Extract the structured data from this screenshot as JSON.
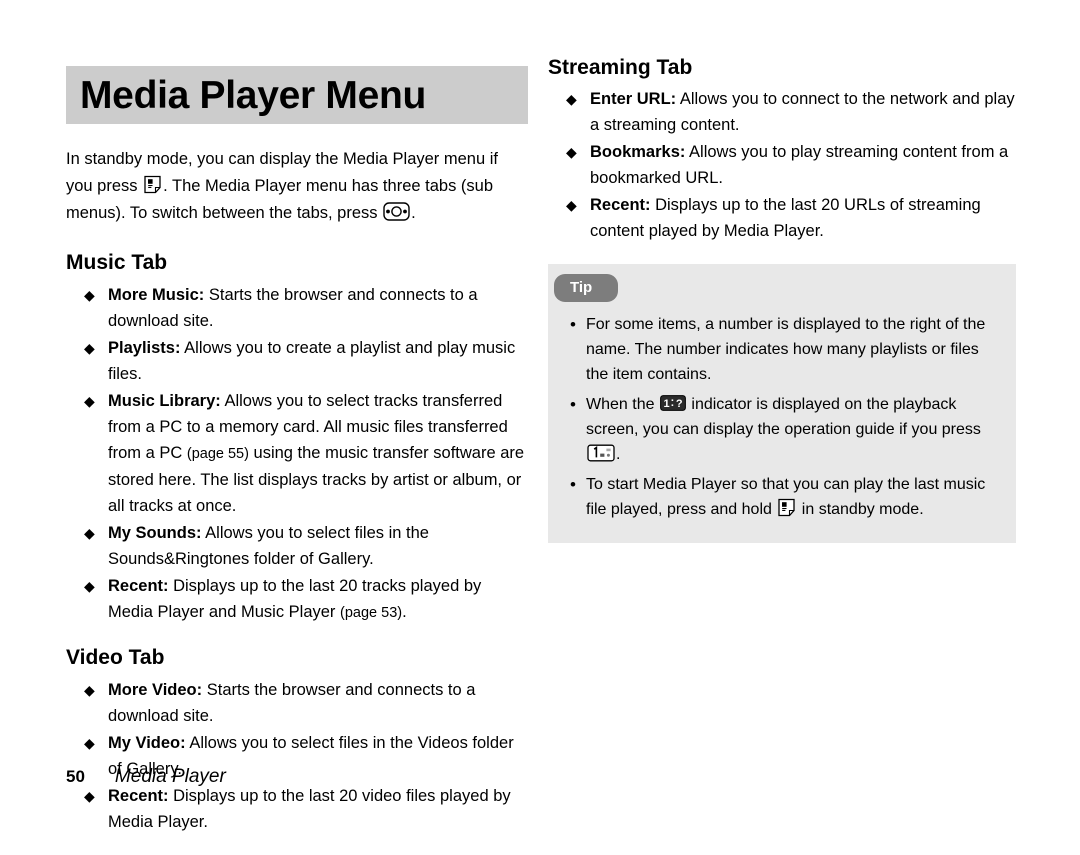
{
  "page": {
    "title": "Media Player Menu",
    "footer_page_number": "50",
    "footer_chapter": "Media Player"
  },
  "intro": {
    "part1": "In standby mode, you can display the Media Player menu if you press ",
    "icon1": "media-player-key-icon",
    "part2": ". The Media Player menu has three tabs (sub menus). To switch between the tabs, press ",
    "icon2": "navigation-key-icon",
    "part3": "."
  },
  "sections": [
    {
      "heading": "Music Tab",
      "items": [
        {
          "term": "More Music:",
          "text": " Starts the browser and connects to a download site."
        },
        {
          "term": "Playlists:",
          "text": " Allows you to create a playlist and play music files."
        },
        {
          "term": "Music Library:",
          "text": " Allows you to select tracks transferred from a PC to a memory card. All music files transferred from a PC ",
          "ref": "(page 55)",
          "text2": " using the music transfer software are stored here. The list displays tracks by artist or album, or all tracks at once."
        },
        {
          "term": "My Sounds:",
          "text": " Allows you to select files in the Sounds&Ringtones folder of Gallery."
        },
        {
          "term": "Recent:",
          "text": " Displays up to the last 20 tracks played by Media Player and Music Player ",
          "ref": "(page 53)",
          "text2": "."
        }
      ]
    },
    {
      "heading": "Video Tab",
      "items": [
        {
          "term": "More Video:",
          "text": " Starts the browser and connects to a download site."
        },
        {
          "term": "My Video:",
          "text": " Allows you to select files in the Videos folder of Gallery."
        },
        {
          "term": "Recent:",
          "text": " Displays up to the last 20 video files played by Media Player."
        }
      ]
    },
    {
      "heading": "Streaming Tab",
      "items": [
        {
          "term": "Enter URL:",
          "text": " Allows you to connect to the network and play a streaming content."
        },
        {
          "term": "Bookmarks:",
          "text": " Allows you to play streaming content from a bookmarked URL."
        },
        {
          "term": "Recent:",
          "text": " Displays up to the last 20 URLs of streaming content played by Media Player."
        }
      ]
    }
  ],
  "tip": {
    "label": "Tip",
    "items": [
      {
        "text": "For some items, a number is displayed to the right of the name. The number indicates how many playlists or files the item contains."
      },
      {
        "pre": "When the ",
        "icon": "playback-indicator-icon",
        "mid": " indicator is displayed on the playback screen, you can display the operation guide if you press ",
        "icon2": "number-key-1-icon",
        "post": "."
      },
      {
        "pre": "To start Media Player so that you can play the last music file played, press and hold ",
        "icon": "media-player-key-icon",
        "post": " in standby mode."
      }
    ]
  },
  "symbols": {
    "diamond_bullet": "◆",
    "dot_bullet": "•"
  },
  "colors": {
    "banner_gray": "#cccccc",
    "tip_bg": "#e8e8e8",
    "tip_pill": "#7d7d7d",
    "text": "#000000"
  }
}
